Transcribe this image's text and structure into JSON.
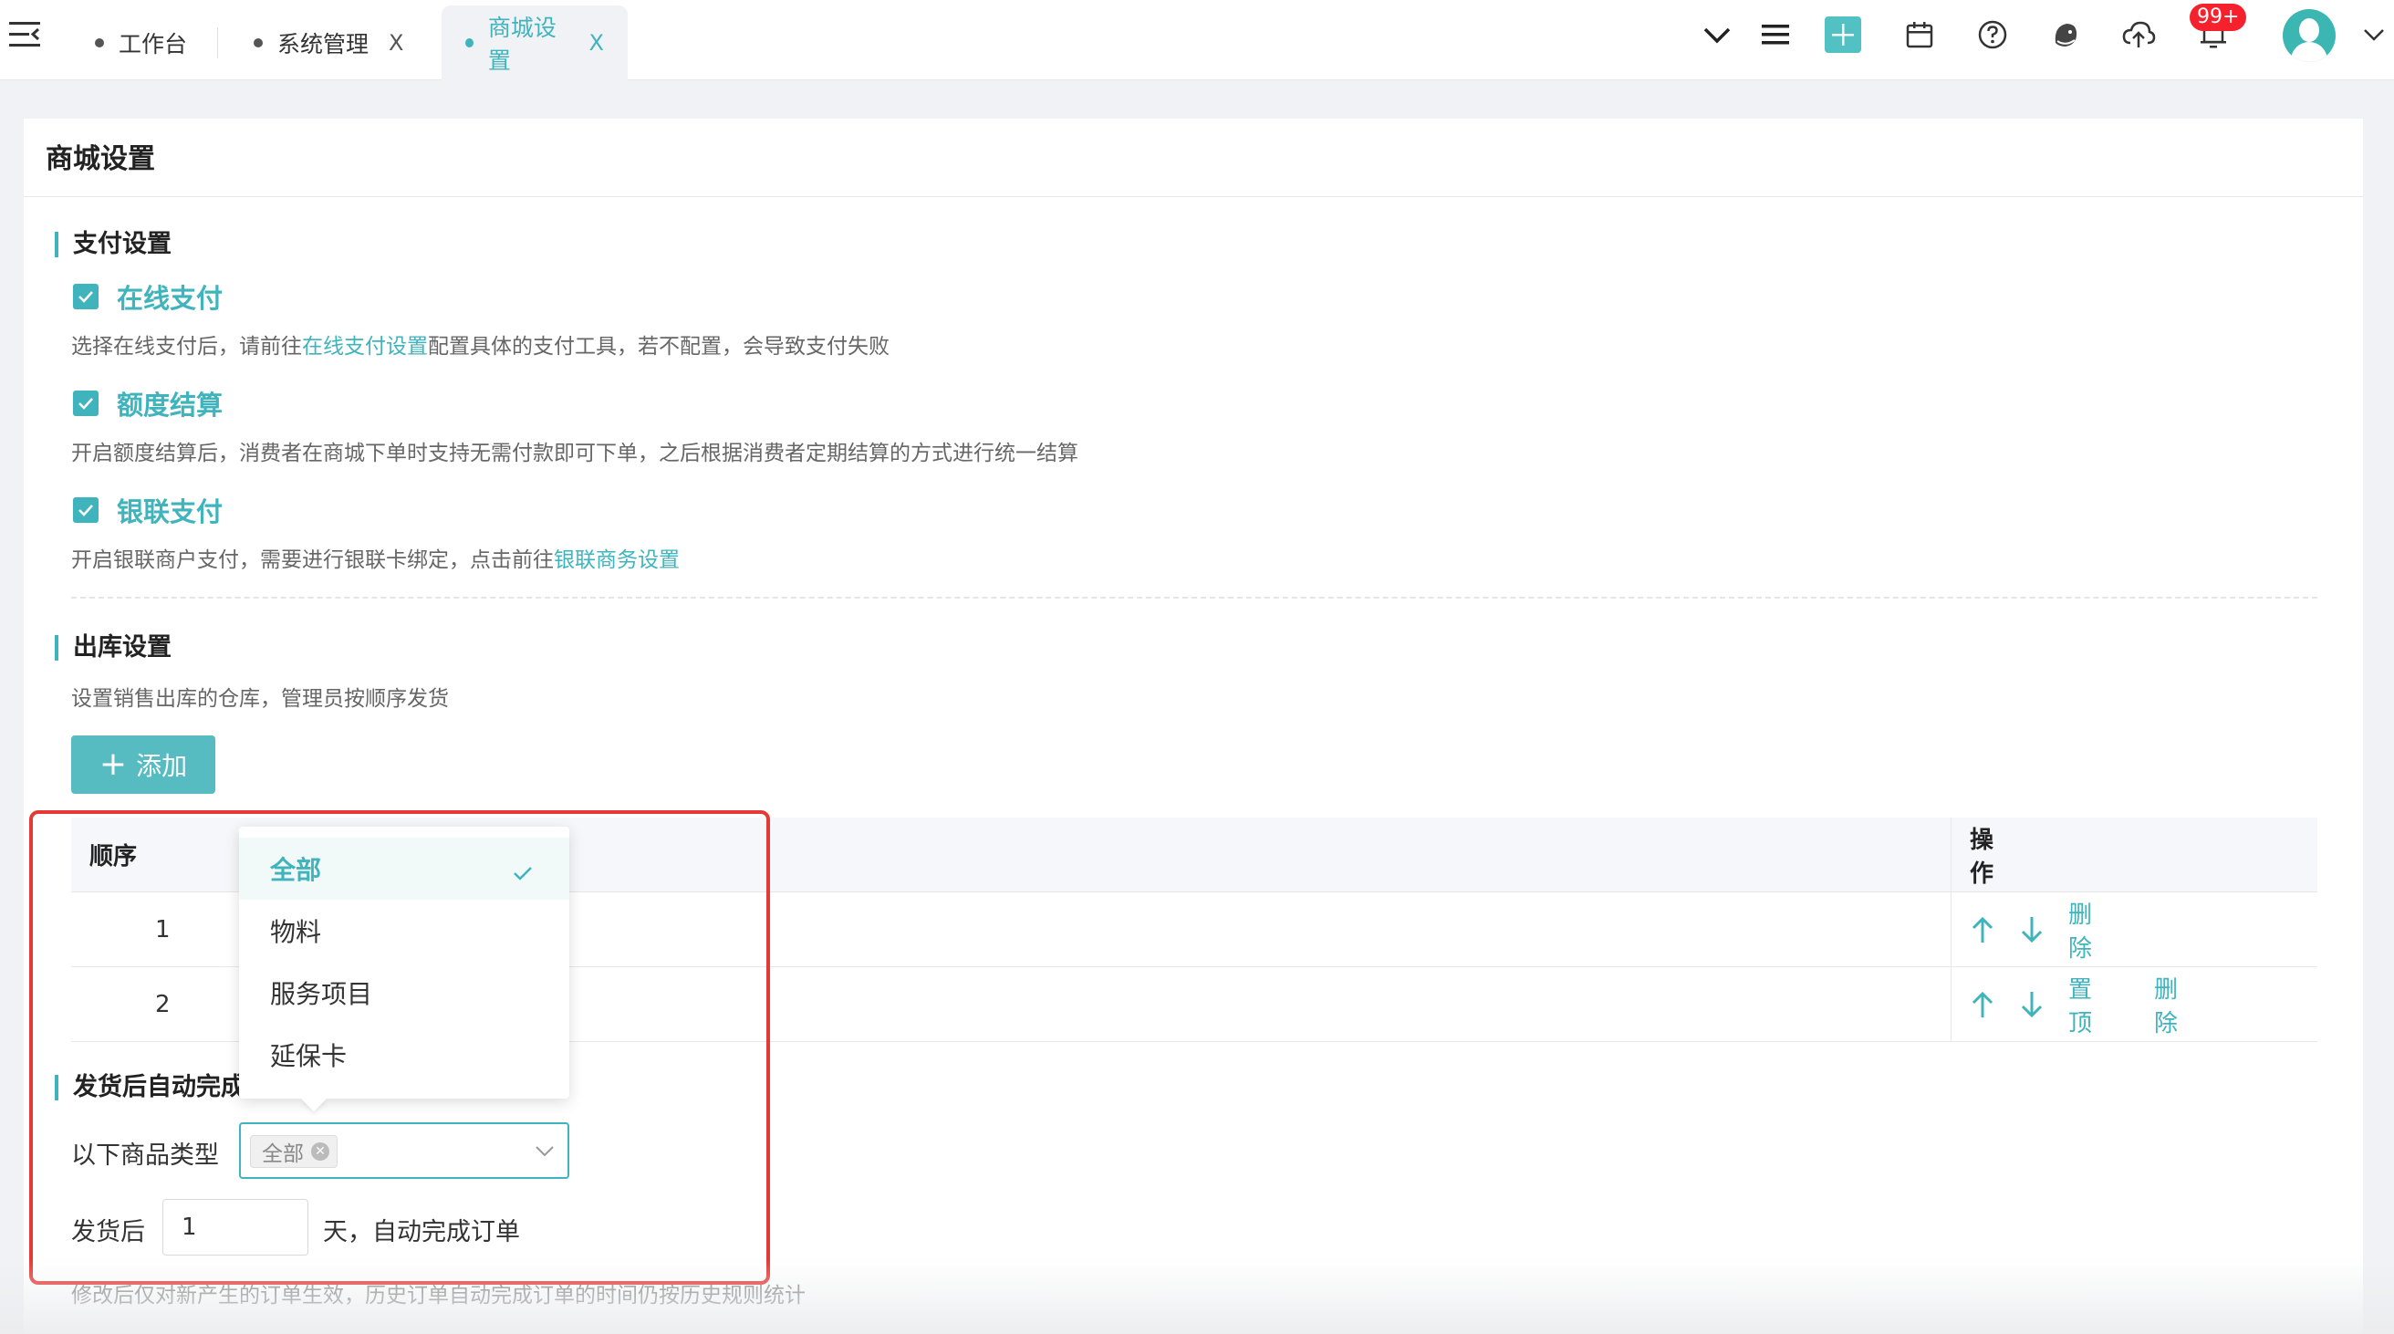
{
  "tabs": [
    {
      "label": "工作台",
      "closable": false,
      "active": false
    },
    {
      "label": "系统管理",
      "closable": true,
      "active": false
    },
    {
      "label": "商城设置",
      "closable": true,
      "active": true
    }
  ],
  "tab_close_glyph": "X",
  "notifications": {
    "badge": "99+"
  },
  "header_icons": [
    "chevron-down-icon",
    "list-menu-icon",
    "add-square-icon",
    "calendar-icon",
    "help-icon",
    "avatar-bird-icon",
    "cloud-upload-icon",
    "bell-icon"
  ],
  "colors": {
    "accent": "#40b4bc",
    "badge": "#f5222d",
    "highlight_box": "#e53935"
  },
  "page_title": "商城设置",
  "payment": {
    "title": "支付设置",
    "online": {
      "label": "在线支付",
      "checked": true,
      "desc_before": "选择在线支付后，请前往",
      "desc_link": "在线支付设置",
      "desc_after": "配置具体的支付工具，若不配置，会导致支付失败"
    },
    "quota": {
      "label": "额度结算",
      "checked": true,
      "desc": "开启额度结算后，消费者在商城下单时支持无需付款即可下单，之后根据消费者定期结算的方式进行统一结算"
    },
    "unionpay": {
      "label": "银联支付",
      "checked": true,
      "desc_before": "开启银联商户支付，需要进行银联卡绑定，点击前往",
      "desc_link": "银联商务设置"
    }
  },
  "warehouse": {
    "title": "出库设置",
    "desc": "设置销售出库的仓库，管理员按顺序发货",
    "add_button": "添加",
    "table": {
      "col_order": "顺序",
      "col_ops": "操作",
      "rows": [
        {
          "order": "1",
          "top": "",
          "delete": "删除"
        },
        {
          "order": "2",
          "top": "置顶",
          "delete": "删除"
        }
      ]
    }
  },
  "auto_complete": {
    "title": "发货后自动完成",
    "type_label": "以下商品类型",
    "selected_tag": "全部",
    "after_label": "发货后",
    "days_value": "1",
    "days_suffix": "天，自动完成订单",
    "note": "修改后仅对新产生的订单生效，历史订单自动完成订单的时间仍按历史规则统计"
  },
  "dropdown": {
    "options": [
      "全部",
      "物料",
      "服务项目",
      "延保卡"
    ],
    "selected": "全部"
  }
}
